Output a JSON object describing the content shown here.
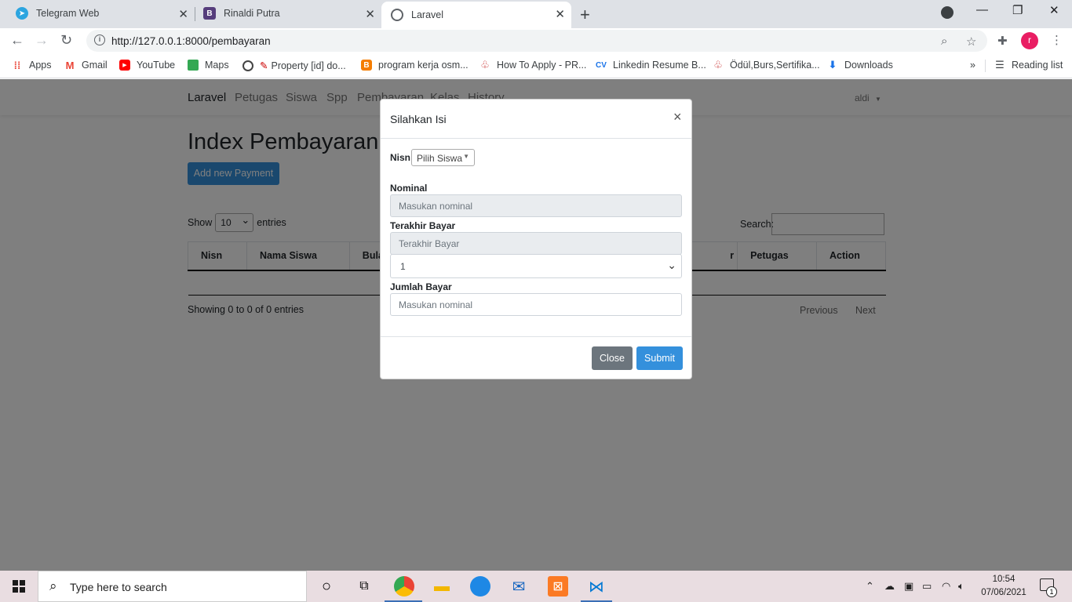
{
  "browser": {
    "tabs": [
      {
        "title": "Telegram Web",
        "icon": "telegram-icon",
        "color": "#2ca5e0"
      },
      {
        "title": "Rinaldi Putra",
        "icon": "bootstrap-icon",
        "color": "#563d7c"
      },
      {
        "title": "Laravel",
        "icon": "globe-icon",
        "color": "#5f6368"
      }
    ],
    "url": "http://127.0.0.1:8000/pembayaran",
    "profile_initial": "r",
    "bookmarks": [
      {
        "label": "Apps",
        "icon": "apps-grid-icon"
      },
      {
        "label": "Gmail",
        "icon": "gmail-icon"
      },
      {
        "label": "YouTube",
        "icon": "youtube-icon"
      },
      {
        "label": "Maps",
        "icon": "maps-icon"
      },
      {
        "label": "Property [id] do...",
        "icon": "globe-icon"
      },
      {
        "label": "program kerja osm...",
        "icon": "blogger-icon"
      },
      {
        "label": "How To Apply - PR...",
        "icon": "tulip-icon"
      },
      {
        "label": "Linkedin Resume B...",
        "icon": "cv-icon"
      },
      {
        "label": "Ödül,Burs,Sertifika...",
        "icon": "tulip-icon"
      },
      {
        "label": "Downloads",
        "icon": "download-icon"
      }
    ],
    "overflow": "»",
    "reading_list": "Reading list"
  },
  "app": {
    "brand": "Laravel",
    "nav": [
      "Petugas",
      "Siswa",
      "Spp",
      "Pembayaran",
      "Kelas",
      "History"
    ],
    "user": "aldi",
    "page_title": "Index Pembayaran",
    "add_button": "Add new Payment",
    "show_label": "Show",
    "entries_value": "10",
    "entries_label": "entries",
    "search_label": "Search:",
    "columns": [
      "Nisn",
      "Nama Siswa",
      "Bula",
      "r",
      "Petugas",
      "Action"
    ],
    "info": "Showing 0 to 0 of 0 entries",
    "previous": "Previous",
    "next": "Next"
  },
  "modal": {
    "title": "Silahkan Isi",
    "close_x": "×",
    "nisn_label": "Nisn",
    "nisn_select": "Pilih Siswa",
    "nominal_label": "Nominal",
    "nominal_placeholder": "Masukan nominal",
    "terakhir_label": "Terakhir Bayar",
    "terakhir_placeholder": "Terakhir Bayar",
    "bulan_value": "1",
    "jumlah_label": "Jumlah Bayar",
    "jumlah_placeholder": "Masukan nominal",
    "close_button": "Close",
    "submit_button": "Submit"
  },
  "taskbar": {
    "search_placeholder": "Type here to search",
    "time": "10:54",
    "date": "07/06/2021",
    "notifications": "1"
  }
}
